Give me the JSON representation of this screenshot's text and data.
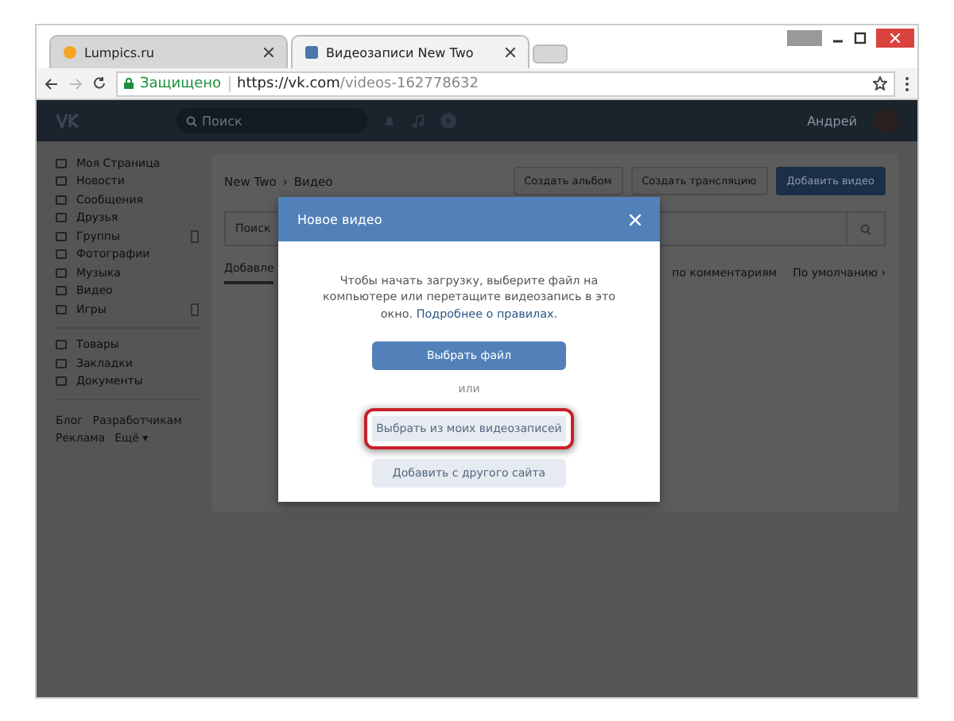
{
  "browser": {
    "tabs": [
      {
        "title": "Lumpics.ru",
        "selected": false
      },
      {
        "title": "Видеозаписи New Two",
        "selected": true
      }
    ],
    "address": {
      "security": "Защищено",
      "host": "https://vk.com",
      "path": "/videos-162778632"
    }
  },
  "header": {
    "search_placeholder": "Поиск",
    "user": "Андрей"
  },
  "sidebar": {
    "groups": [
      [
        {
          "label": "Моя Страница"
        },
        {
          "label": "Новости"
        },
        {
          "label": "Сообщения"
        },
        {
          "label": "Друзья"
        },
        {
          "label": "Группы",
          "badge": true
        },
        {
          "label": "Фотографии"
        },
        {
          "label": "Музыка"
        },
        {
          "label": "Видео"
        },
        {
          "label": "Игры",
          "badge": true
        }
      ],
      [
        {
          "label": "Товары"
        },
        {
          "label": "Закладки"
        },
        {
          "label": "Документы"
        }
      ]
    ],
    "footer": [
      "Блог",
      "Разработчикам",
      "Реклама",
      "Ещё ▾"
    ]
  },
  "content": {
    "breadcrumb": [
      "New Two",
      "Видео"
    ],
    "breadcrumb_separator": "›",
    "buttons": [
      {
        "label": "Создать альбом",
        "primary": false
      },
      {
        "label": "Создать трансляцию",
        "primary": false
      },
      {
        "label": "Добавить видео",
        "primary": true
      }
    ],
    "search_placeholder": "Поиск",
    "tab": "Добавле",
    "sort": [
      "по комментариям",
      "По умолчанию ›"
    ]
  },
  "modal": {
    "title": "Новое видео",
    "text": "Чтобы начать загрузку, выберите файл на компьютере или перетащите видеозапись в это окно.",
    "link": "Подробнее о правилах.",
    "actions": [
      {
        "label": "Выбрать файл",
        "kind": "primary",
        "highlighted": false
      },
      {
        "label": "или",
        "kind": "separator"
      },
      {
        "label": "Выбрать из моих видеозаписей",
        "kind": "secondary",
        "highlighted": true
      },
      {
        "label": "Добавить с другого сайта",
        "kind": "secondary",
        "highlighted": false
      }
    ]
  }
}
